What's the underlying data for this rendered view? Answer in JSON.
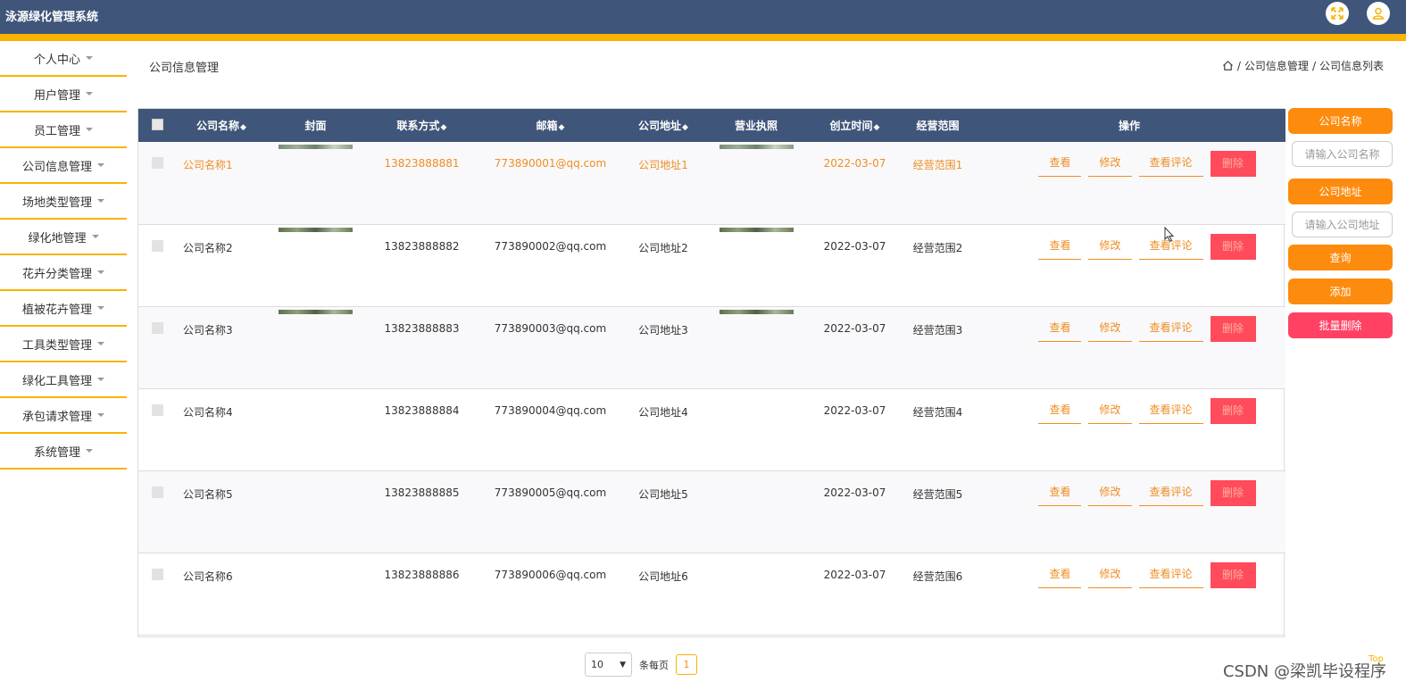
{
  "header": {
    "title": "泳源绿化管理系统"
  },
  "sidebar": {
    "items": [
      {
        "label": "个人中心"
      },
      {
        "label": "用户管理"
      },
      {
        "label": "员工管理"
      },
      {
        "label": "公司信息管理"
      },
      {
        "label": "场地类型管理"
      },
      {
        "label": "绿化地管理"
      },
      {
        "label": "花卉分类管理"
      },
      {
        "label": "植被花卉管理"
      },
      {
        "label": "工具类型管理"
      },
      {
        "label": "绿化工具管理"
      },
      {
        "label": "承包请求管理"
      },
      {
        "label": "系统管理"
      }
    ]
  },
  "page": {
    "title": "公司信息管理",
    "breadcrumb": {
      "sep1": "/",
      "item1": "公司信息管理",
      "sep2": "/",
      "item2": "公司信息列表"
    }
  },
  "table": {
    "columns": {
      "name": "公司名称",
      "cover": "封面",
      "phone": "联系方式",
      "email": "邮箱",
      "address": "公司地址",
      "license": "营业执照",
      "created": "创立时间",
      "scope": "经营范围",
      "ops": "操作"
    },
    "sort_mark": "◆",
    "ops": {
      "view": "查看",
      "edit": "修改",
      "comments": "查看评论",
      "delete": "删除"
    },
    "rows": [
      {
        "name": "公司名称1",
        "phone": "13823888881",
        "email": "773890001@qq.com",
        "address": "公司地址1",
        "created": "2022-03-07",
        "scope": "经营范围1"
      },
      {
        "name": "公司名称2",
        "phone": "13823888882",
        "email": "773890002@qq.com",
        "address": "公司地址2",
        "created": "2022-03-07",
        "scope": "经营范围2"
      },
      {
        "name": "公司名称3",
        "phone": "13823888883",
        "email": "773890003@qq.com",
        "address": "公司地址3",
        "created": "2022-03-07",
        "scope": "经营范围3"
      },
      {
        "name": "公司名称4",
        "phone": "13823888884",
        "email": "773890004@qq.com",
        "address": "公司地址4",
        "created": "2022-03-07",
        "scope": "经营范围4"
      },
      {
        "name": "公司名称5",
        "phone": "13823888885",
        "email": "773890005@qq.com",
        "address": "公司地址5",
        "created": "2022-03-07",
        "scope": "经营范围5"
      },
      {
        "name": "公司名称6",
        "phone": "13823888886",
        "email": "773890006@qq.com",
        "address": "公司地址6",
        "created": "2022-03-07",
        "scope": "经营范围6"
      }
    ]
  },
  "search": {
    "name_label": "公司名称",
    "name_placeholder": "请输入公司名称",
    "address_label": "公司地址",
    "address_placeholder": "请输入公司地址",
    "query_button": "查询",
    "add_button": "添加",
    "batch_delete_button": "批量删除"
  },
  "pagination": {
    "page_size": "10",
    "per_page_label": "条每页",
    "current_page": "1"
  },
  "misc": {
    "top_link": "Top",
    "watermark": "CSDN @梁凯毕设程序"
  },
  "colors": {
    "header": "#40557a",
    "accent": "#f9b300",
    "link": "#f08d23",
    "danger": "#ff4b5c",
    "button": "#fd8b0d"
  }
}
